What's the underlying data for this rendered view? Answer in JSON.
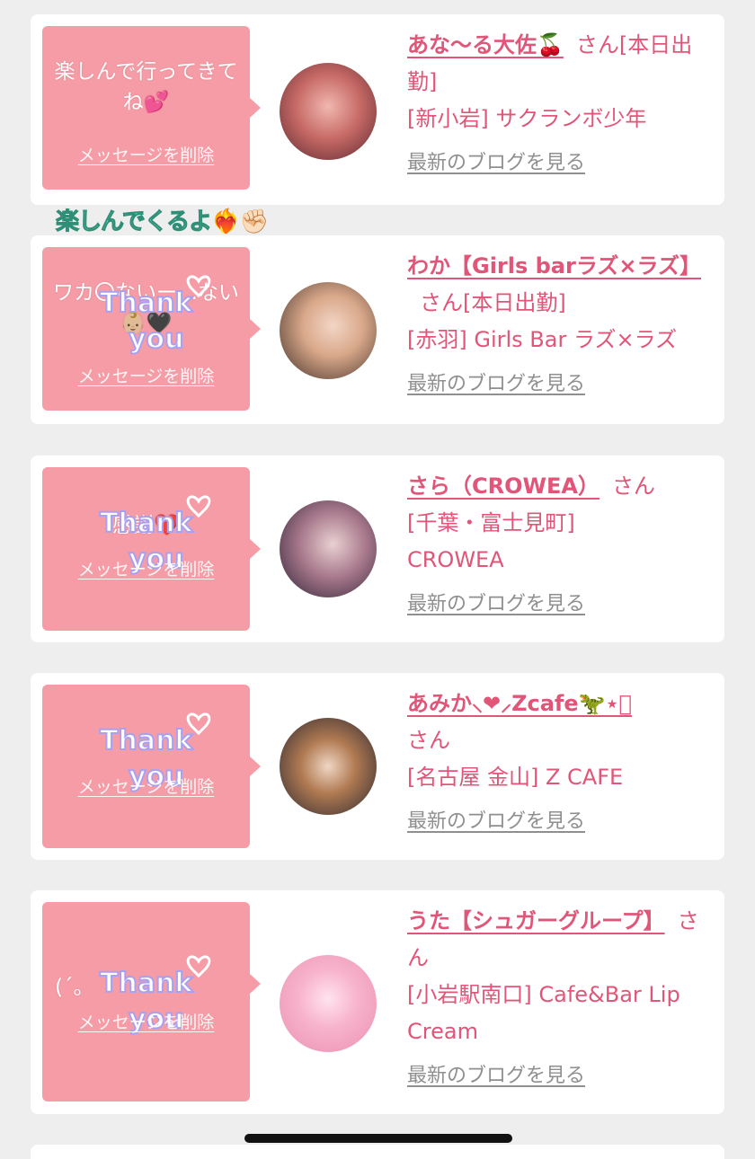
{
  "common": {
    "delete_label": "メッセージを削除",
    "blog_label": "最新のブログを見る",
    "san": "さん"
  },
  "sticker_overlay": "楽しんでくるよ❤️‍🔥✊🏻",
  "cards": [
    {
      "message": "楽しんで行ってきてね💕",
      "name": "あな〜る大佐🍒",
      "status": "[本日出勤]",
      "shop": "[新小岩] サクランボ少年"
    },
    {
      "message": "ワカ〇ないー…ない👶🏼🖤",
      "name": "わか【Girls barラズ×ラズ】",
      "status": "[本日出勤]",
      "shop": "[赤羽] Girls Bar ラズ×ラズ"
    },
    {
      "message": "感謝❤️",
      "name": "さら（CROWEA）",
      "status": "",
      "shop": "[千葉・富士見町] CROWEA"
    },
    {
      "message": "",
      "name": "あみか⸜❤︎⸝Zcafe🦖⋆͛",
      "status": "",
      "shop": "[名古屋 金山] Z CAFE"
    },
    {
      "message": "(´。",
      "name": "うた【シュガーグループ】",
      "status": "",
      "shop": "[小岩駅南口] Cafe&Bar Lip Cream"
    }
  ],
  "colors": {
    "bubble": "#f69ca6",
    "accent": "#e05578",
    "link_gray": "#8f8f8f",
    "background": "#eeeeee"
  }
}
